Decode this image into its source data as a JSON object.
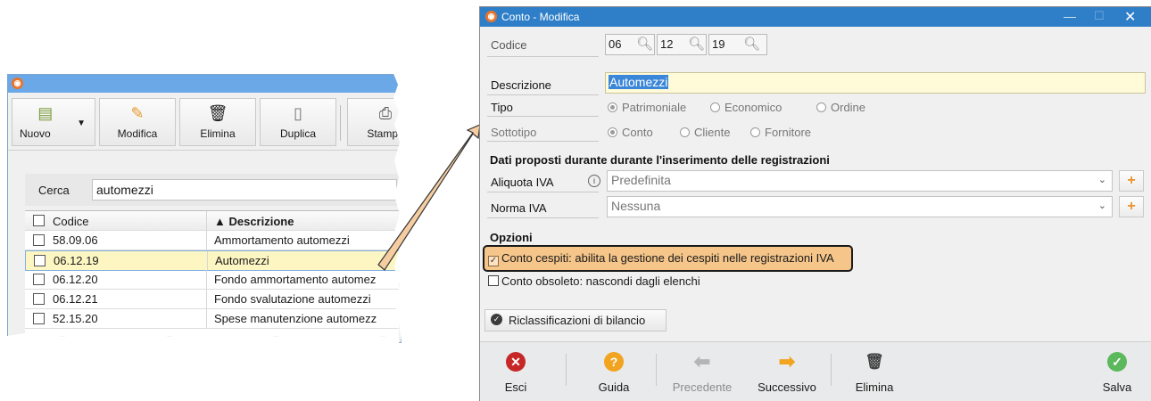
{
  "left_window": {
    "toolbar": {
      "nuovo": "Nuovo",
      "modifica": "Modifica",
      "elimina": "Elimina",
      "duplica": "Duplica",
      "stampa": "Stampa"
    },
    "search": {
      "label": "Cerca",
      "value": "automezzi"
    },
    "grid": {
      "col_codice": "Codice",
      "col_descrizione": "▲ Descrizione",
      "rows": [
        {
          "codice": "58.09.06",
          "descrizione": "Ammortamento automezzi"
        },
        {
          "codice": "06.12.19",
          "descrizione": "Automezzi"
        },
        {
          "codice": "06.12.20",
          "descrizione": "Fondo ammortamento automez"
        },
        {
          "codice": "06.12.21",
          "descrizione": "Fondo svalutazione automezzi"
        },
        {
          "codice": "52.15.20",
          "descrizione": "Spese manutenzione automezz"
        }
      ]
    }
  },
  "dialog": {
    "title": "Conto - Modifica",
    "codice_label": "Codice",
    "codice": [
      "06",
      "12",
      "19"
    ],
    "descrizione_label": "Descrizione",
    "descrizione_value": "Automezzi",
    "tipo_label": "Tipo",
    "tipo_options": [
      "Patrimoniale",
      "Economico",
      "Ordine"
    ],
    "sottotipo_label": "Sottotipo",
    "sottotipo_options": [
      "Conto",
      "Cliente",
      "Fornitore"
    ],
    "section_dati": "Dati proposti durante durante l'inserimento delle registrazioni",
    "aliquota_label": "Aliquota IVA",
    "aliquota_value": "Predefinita",
    "norma_label": "Norma IVA",
    "norma_value": "Nessuna",
    "opzioni_label": "Opzioni",
    "cespiti_checkbox": "Conto cespiti: abilita la gestione dei cespiti nelle registrazioni IVA",
    "obsoleto_checkbox": "Conto obsoleto: nascondi dagli elenchi",
    "riclass_button": "Riclassificazioni di bilancio",
    "bottom": {
      "esci": "Esci",
      "guida": "Guida",
      "precedente": "Precedente",
      "successivo": "Successivo",
      "elimina": "Elimina",
      "salva": "Salva"
    }
  },
  "colors": {
    "accent_blue": "#2f7fc8",
    "highlight_orange": "#f5c58a",
    "arrow_fill": "#f6cda0",
    "selected_row": "#fdf6c3"
  }
}
